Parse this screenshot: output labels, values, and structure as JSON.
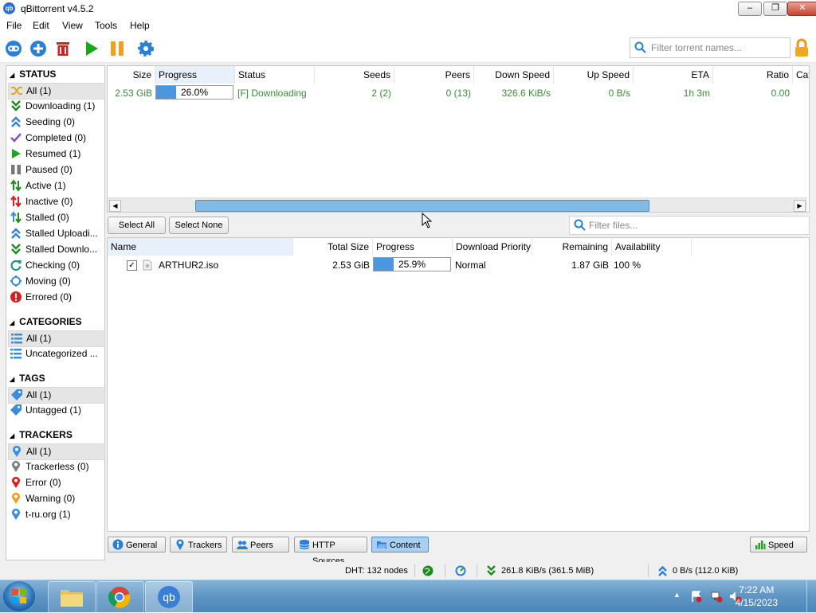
{
  "window": {
    "title": "qBittorrent v4.5.2",
    "app_icon_label": "qb"
  },
  "menu": [
    "File",
    "Edit",
    "View",
    "Tools",
    "Help"
  ],
  "search": {
    "placeholder": "Filter torrent names..."
  },
  "sidebar": {
    "status_title": "STATUS",
    "status_items": [
      {
        "label": "All (1)",
        "icon": "all-icon"
      },
      {
        "label": "Downloading (1)",
        "icon": "downloading-icon"
      },
      {
        "label": "Seeding (0)",
        "icon": "seeding-icon"
      },
      {
        "label": "Completed (0)",
        "icon": "completed-icon"
      },
      {
        "label": "Resumed (1)",
        "icon": "resumed-icon"
      },
      {
        "label": "Paused (0)",
        "icon": "paused-icon"
      },
      {
        "label": "Active (1)",
        "icon": "active-icon"
      },
      {
        "label": "Inactive (0)",
        "icon": "inactive-icon"
      },
      {
        "label": "Stalled (0)",
        "icon": "stalled-icon"
      },
      {
        "label": "Stalled Uploadi...",
        "icon": "stalled-uploading-icon"
      },
      {
        "label": "Stalled Downlo...",
        "icon": "stalled-downloading-icon"
      },
      {
        "label": "Checking (0)",
        "icon": "checking-icon"
      },
      {
        "label": "Moving (0)",
        "icon": "moving-icon"
      },
      {
        "label": "Errored (0)",
        "icon": "errored-icon"
      }
    ],
    "categories_title": "CATEGORIES",
    "categories": [
      {
        "label": "All (1)"
      },
      {
        "label": "Uncategorized ..."
      }
    ],
    "tags_title": "TAGS",
    "tags": [
      {
        "label": "All (1)"
      },
      {
        "label": "Untagged (1)"
      }
    ],
    "trackers_title": "TRACKERS",
    "trackers": [
      {
        "label": "All (1)",
        "color": "#3b8de0"
      },
      {
        "label": "Trackerless (0)",
        "color": "#808080"
      },
      {
        "label": "Error (0)",
        "color": "#e02020"
      },
      {
        "label": "Warning (0)",
        "color": "#f0a020"
      },
      {
        "label": "t-ru.org (1)",
        "color": "#3b8de0"
      }
    ]
  },
  "torrent_table": {
    "headers": {
      "size": "Size",
      "progress": "Progress",
      "status": "Status",
      "seeds": "Seeds",
      "peers": "Peers",
      "down_speed": "Down Speed",
      "up_speed": "Up Speed",
      "eta": "ETA",
      "ratio": "Ratio",
      "category": "Cat"
    },
    "row": {
      "size": "2.53 GiB",
      "progress_text": "26.0%",
      "progress": 0.26,
      "status": "[F] Downloading",
      "seeds": "2 (2)",
      "peers": "0 (13)",
      "down_speed": "326.6 KiB/s",
      "up_speed": "0 B/s",
      "eta": "1h 3m",
      "ratio": "0.00"
    }
  },
  "content_toolbar": {
    "select_all": "Select All",
    "select_none": "Select None",
    "filter_placeholder": "Filter files..."
  },
  "content_table": {
    "headers": {
      "name": "Name",
      "total_size": "Total Size",
      "progress": "Progress",
      "priority": "Download Priority",
      "remaining": "Remaining",
      "availability": "Availability"
    },
    "row": {
      "name": "ARTHUR2.iso",
      "total_size": "2.53 GiB",
      "progress_text": "25.9%",
      "progress": 0.259,
      "priority": "Normal",
      "remaining": "1.87 GiB",
      "availability": "100 %",
      "checked": true
    }
  },
  "tabs": [
    "General",
    "Trackers",
    "Peers",
    "HTTP Sources",
    "Content"
  ],
  "selected_tab": "Content",
  "speed_button": "Speed",
  "statusbar": {
    "dht": "DHT: 132 nodes",
    "download": "261.8 KiB/s (361.5 MiB)",
    "upload": "0 B/s (112.0 KiB)"
  },
  "taskbar": {
    "time": "7:22 AM",
    "date": "4/15/2023"
  },
  "colors": {
    "accent": "#4a97df",
    "status_text": "#3d8a3a",
    "selected_tab": "#a9cff3"
  }
}
